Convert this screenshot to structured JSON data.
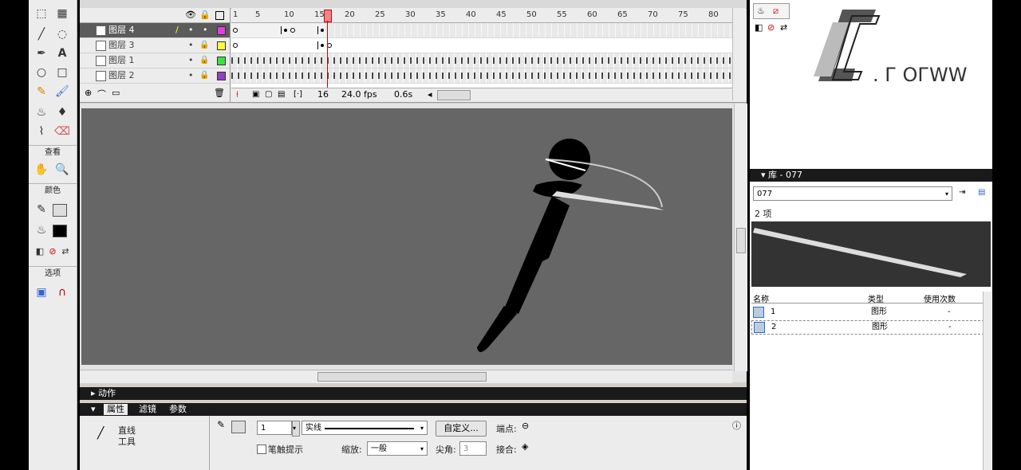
{
  "timeline": {
    "ruler_numbers": [
      "1",
      "5",
      "10",
      "15",
      "20",
      "25",
      "30",
      "35",
      "40",
      "45",
      "50",
      "55",
      "60",
      "65",
      "70",
      "75",
      "80"
    ],
    "layers": [
      {
        "name": "图层 4",
        "color": "#e040e0",
        "selected": true
      },
      {
        "name": "图层 3",
        "color": "#ffff40",
        "selected": false
      },
      {
        "name": "图层 1",
        "color": "#40e040",
        "selected": false
      },
      {
        "name": "图层 2",
        "color": "#9040c0",
        "selected": false
      }
    ],
    "current_frame": "16",
    "fps": "24.0 fps",
    "time": "0.6s"
  },
  "tools": {
    "view_label": "查看",
    "colors_label": "颜色",
    "options_label": "选项"
  },
  "panels": {
    "actions_label": "动作",
    "properties_tab": "属性",
    "filters_tab": "滤镜",
    "params_tab": "参数"
  },
  "properties": {
    "tool_name_line1": "直线",
    "tool_name_line2": "工具",
    "stroke_width": "1",
    "stroke_style": "实线",
    "custom_button": "自定义...",
    "cap_label": "端点:",
    "hinting_label": "笔触提示",
    "scale_label": "缩放:",
    "scale_value": "一般",
    "miter_label": "尖角:",
    "miter_value": "3",
    "join_label": "接合:"
  },
  "library": {
    "title": "库 - 077",
    "selected_doc": "077",
    "item_count": "2 项",
    "col_name": "名称",
    "col_type": "类型",
    "col_uses": "使用次数",
    "items": [
      {
        "name": "1",
        "type": "图形",
        "uses": "-"
      },
      {
        "name": "2",
        "type": "图形",
        "uses": "-"
      }
    ]
  },
  "watermark_text": ". Г ОГWW"
}
